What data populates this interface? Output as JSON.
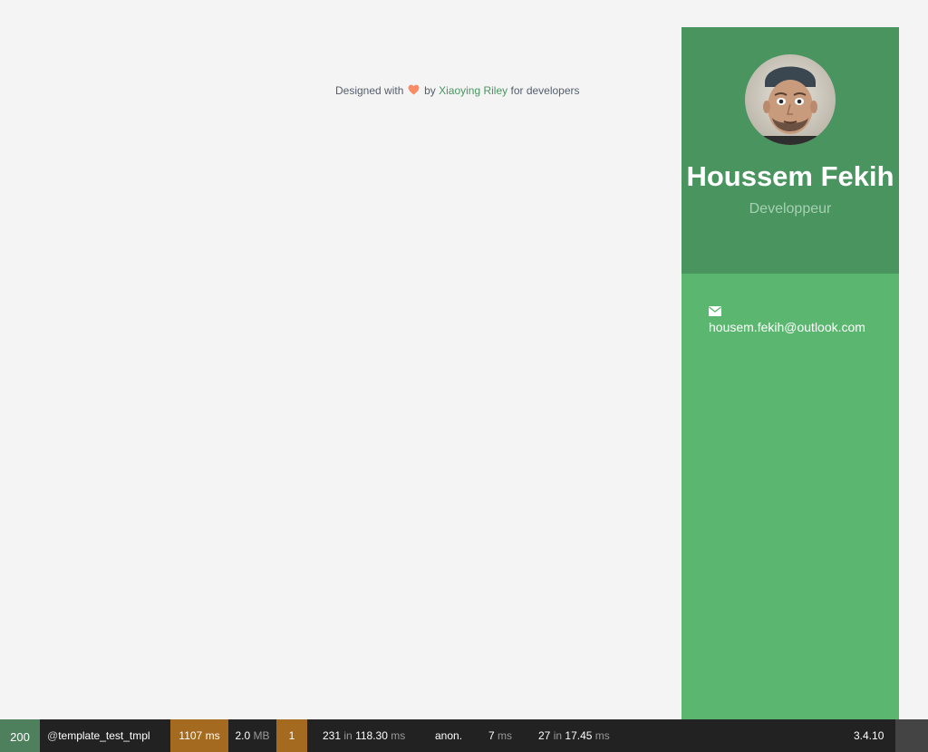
{
  "credit": {
    "prefix": "Designed with",
    "by": "by",
    "author": "Xiaoying Riley",
    "suffix": "for developers"
  },
  "profile": {
    "name": "Houssem Fekih",
    "tagline": "Developpeur",
    "email": "housem.fekih@outlook.com"
  },
  "colors": {
    "profile_bg": "#4a9460",
    "sidebar_bg": "#5bb66f",
    "heart": "#f88c67",
    "toolbar_bg": "#222222",
    "warning": "#a46a1f"
  },
  "icons": {
    "heart": "heart-icon",
    "email": "envelope-icon"
  },
  "toolbar": {
    "status": "200",
    "route_at": "@",
    "route": "template_test_tmpl",
    "time_value": "1107",
    "time_unit": "ms",
    "memory_value": "2.0",
    "memory_unit": "MB",
    "errors": "1",
    "logs_count": "231",
    "logs_in": "in",
    "logs_time": "118.30",
    "logs_unit": "ms",
    "user": "anon.",
    "twig_time": "7",
    "twig_unit": "ms",
    "db_count": "27",
    "db_in": "in",
    "db_time": "17.45",
    "db_unit": "ms",
    "version": "3.4.10"
  }
}
